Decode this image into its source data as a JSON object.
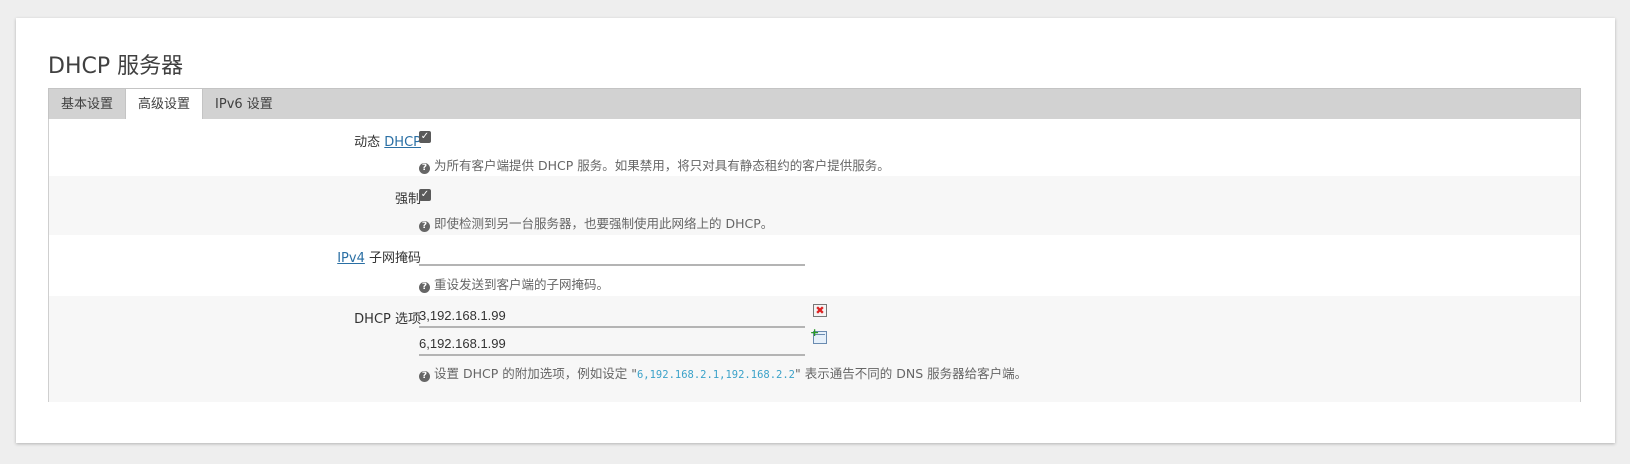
{
  "section": {
    "title": "DHCP 服务器"
  },
  "tabs": [
    {
      "label": "基本设置",
      "active": false
    },
    {
      "label": "高级设置",
      "active": true
    },
    {
      "label": "IPv6 设置",
      "active": false
    }
  ],
  "fields": {
    "dynamic_dhcp": {
      "label_prefix": "动态 ",
      "label_link": "DHCP",
      "checked": true,
      "help": "为所有客户端提供 DHCP 服务。如果禁用，将只对具有静态租约的客户提供服务。"
    },
    "force": {
      "label": "强制",
      "checked": true,
      "help": "即使检测到另一台服务器，也要强制使用此网络上的 DHCP。"
    },
    "ipv4_netmask": {
      "label_link": "IPv4",
      "label_suffix": " 子网掩码",
      "value": "",
      "help": "重设发送到客户端的子网掩码。"
    },
    "dhcp_options": {
      "label": "DHCP 选项",
      "values": [
        "3,192.168.1.99",
        "6,192.168.1.99"
      ],
      "help_prefix": "设置 DHCP 的附加选项，例如设定 \"",
      "help_code": "6,192.168.2.1,192.168.2.2",
      "help_suffix": "\" 表示通告不同的 DNS 服务器给客户端。"
    }
  },
  "icons": {
    "help": "question-circle-icon",
    "remove": "remove-icon",
    "add": "add-icon",
    "check": "✓",
    "x": "✖",
    "q": "?"
  },
  "colors": {
    "link": "#2a6fa4",
    "code": "#3ba2c9",
    "tab_bar": "#d2d2d2"
  }
}
